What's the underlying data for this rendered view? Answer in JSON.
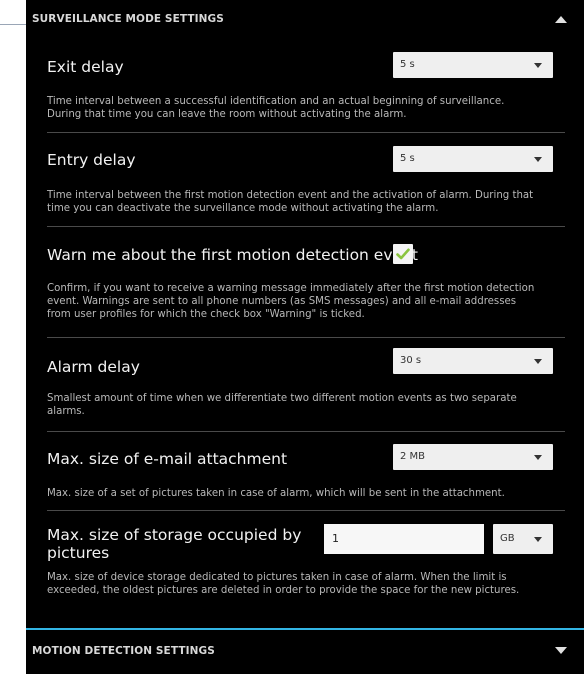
{
  "surveillance": {
    "header": "SURVEILLANCE MODE SETTINGS",
    "exit_delay": {
      "title": "Exit delay",
      "value": "5 s",
      "desc1": "Time interval between a successful identification and an actual beginning of surveillance.",
      "desc2": "During that time you can leave the room without activating the alarm."
    },
    "entry_delay": {
      "title": "Entry delay",
      "value": "5 s",
      "desc1": "Time interval between the first motion detection event and the activation of alarm. During that",
      "desc2": "time you can deactivate the surveillance mode without activating the alarm."
    },
    "warn_first": {
      "title": "Warn me about the first motion detection event",
      "checked": true,
      "desc1": "Confirm, if you want to receive a warning message immediately after the first motion detection",
      "desc2": "event. Warnings are sent to all phone numbers (as SMS messages) and all e-mail addresses",
      "desc3": "from user profiles for which the check box \"Warning\" is ticked."
    },
    "alarm_delay": {
      "title": "Alarm delay",
      "value": "30 s",
      "desc1": "Smallest amount of time when we differentiate two different motion events as two separate",
      "desc2": "alarms."
    },
    "email_attachment": {
      "title": "Max. size of e-mail attachment",
      "value": "2 MB",
      "desc1": "Max. size of a set of pictures taken in case of alarm, which will be sent in the attachment."
    },
    "storage": {
      "title1": "Max. size of storage occupied by",
      "title2": "pictures",
      "input_value": "1",
      "unit": "GB",
      "desc1": "Max. size of device storage dedicated to pictures taken in case of alarm. When the limit is",
      "desc2": "exceeded, the oldest pictures are deleted in order to provide the space for the new pictures."
    }
  },
  "motion": {
    "header": "MOTION DETECTION SETTINGS"
  },
  "colors": {
    "background": "#000000",
    "accent": "#33b5e5",
    "checkmark": "#8ac43f"
  },
  "icons": {
    "collapse": "chevron-up-icon",
    "expand": "chevron-down-icon",
    "dropdown": "caret-down-icon",
    "check": "checkmark-icon"
  }
}
